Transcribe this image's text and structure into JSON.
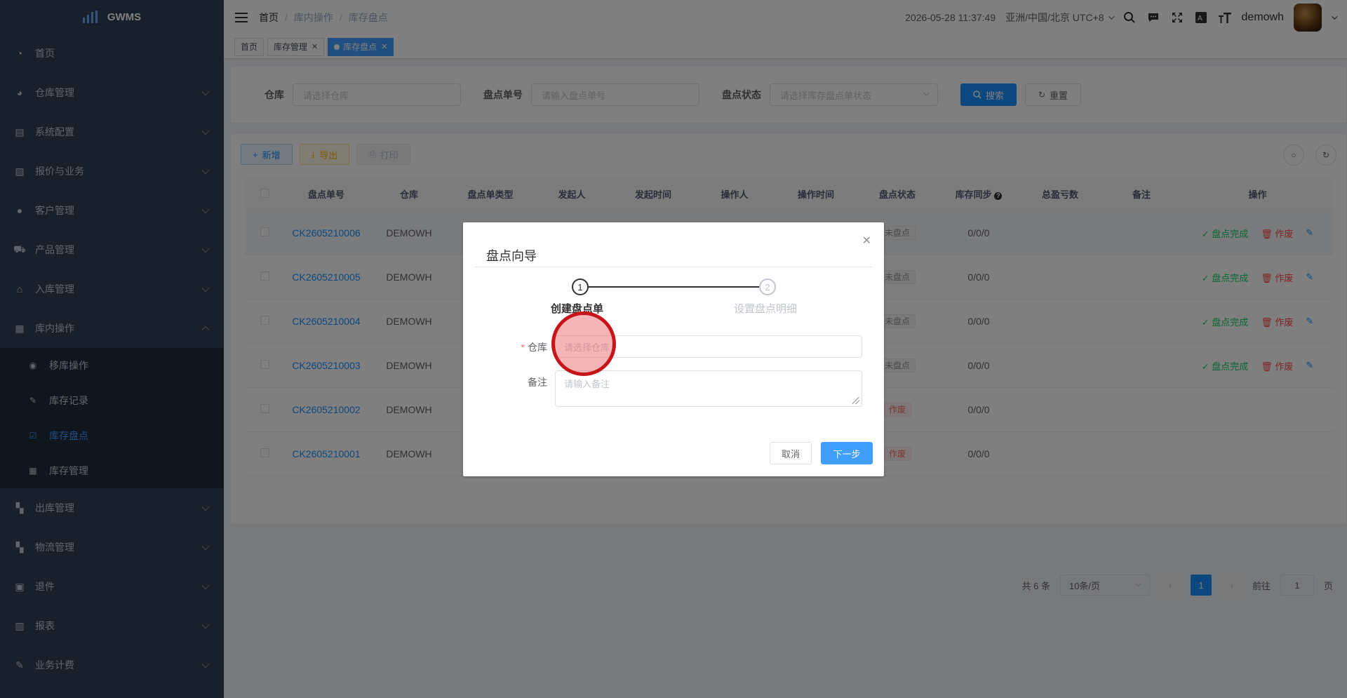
{
  "app": {
    "logo_text": "GWMS"
  },
  "sidebar": {
    "items": [
      {
        "label": "首页",
        "icon": "dashboard-icon"
      },
      {
        "label": "仓库管理",
        "icon": "globe-icon"
      },
      {
        "label": "系统配置",
        "icon": "config-icon"
      },
      {
        "label": "报价与业务",
        "icon": "quote-icon"
      },
      {
        "label": "客户管理",
        "icon": "user-icon"
      },
      {
        "label": "产品管理",
        "icon": "cart-icon"
      },
      {
        "label": "入库管理",
        "icon": "home-icon"
      },
      {
        "label": "库内操作",
        "icon": "table-icon"
      }
    ],
    "submenu": [
      {
        "label": "移库操作",
        "icon": "eye-icon"
      },
      {
        "label": "库存记录",
        "icon": "edit-icon"
      },
      {
        "label": "库存盘点",
        "icon": "checkbox-icon"
      },
      {
        "label": "库存管理",
        "icon": "grid-icon"
      }
    ],
    "items_after": [
      {
        "label": "出库管理",
        "icon": "apps-icon"
      },
      {
        "label": "物流管理",
        "icon": "apps-icon"
      },
      {
        "label": "退件",
        "icon": "return-icon"
      },
      {
        "label": "报表",
        "icon": "chart-icon"
      },
      {
        "label": "业务计费",
        "icon": "bill-icon"
      }
    ]
  },
  "header": {
    "breadcrumb": [
      "首页",
      "库内操作",
      "库存盘点"
    ],
    "datetime": "2026-05-28 11:37:49",
    "timezone": "亚洲/中国/北京 UTC+8",
    "username": "demowh"
  },
  "tags": [
    {
      "label": "首页"
    },
    {
      "label": "库存管理"
    },
    {
      "label": "库存盘点"
    }
  ],
  "search": {
    "warehouse_label": "仓库",
    "warehouse_placeholder": "请选择仓库",
    "order_label": "盘点单号",
    "order_placeholder": "请输入盘点单号",
    "status_label": "盘点状态",
    "status_placeholder": "请选择库存盘点单状态",
    "search_btn": "搜索",
    "reset_btn": "重置"
  },
  "toolbar": {
    "add": "新增",
    "export": "导出",
    "print": "打印"
  },
  "table": {
    "columns": [
      "盘点单号",
      "仓库",
      "盘点单类型",
      "发起人",
      "发起时间",
      "操作人",
      "操作时间",
      "盘点状态",
      "库存同步",
      "总盈亏数",
      "备注",
      "操作"
    ],
    "rows": [
      {
        "no": "CK2605210006",
        "warehouse": "DEMOWH",
        "status": "未盘点",
        "sync": "0/0/0"
      },
      {
        "no": "CK2605210005",
        "warehouse": "DEMOWH",
        "status": "未盘点",
        "sync": "0/0/0"
      },
      {
        "no": "CK2605210004",
        "warehouse": "DEMOWH",
        "status": "未盘点",
        "sync": "0/0/0"
      },
      {
        "no": "CK2605210003",
        "warehouse": "DEMOWH",
        "status": "未盘点",
        "sync": "0/0/0"
      },
      {
        "no": "CK2605210002",
        "warehouse": "DEMOWH",
        "status": "作废",
        "sync": "0/0/0"
      },
      {
        "no": "CK2605210001",
        "warehouse": "DEMOWH",
        "status": "作废",
        "sync": "0/0/0"
      }
    ],
    "op_complete": "盘点完成",
    "op_void": "作废"
  },
  "pager": {
    "total": "共 6 条",
    "page_size": "10条/页",
    "current": "1",
    "goto_label": "前往",
    "goto_value": "1",
    "page_suffix": "页"
  },
  "dialog": {
    "title": "盘点向导",
    "steps": [
      {
        "num": "1",
        "title": "创建盘点单"
      },
      {
        "num": "2",
        "title": "设置盘点明细"
      }
    ],
    "warehouse_label": "仓库",
    "required_mark": "*",
    "warehouse_placeholder": "请选择仓库",
    "remark_label": "备注",
    "remark_placeholder": "请输入备注",
    "cancel_btn": "取消",
    "next_btn": "下一步"
  },
  "colors": {
    "primary": "#1890ff",
    "sidebar_bg": "#304156",
    "success": "#13ce66",
    "danger": "#ff4949",
    "click_marker": "#c8151a"
  }
}
